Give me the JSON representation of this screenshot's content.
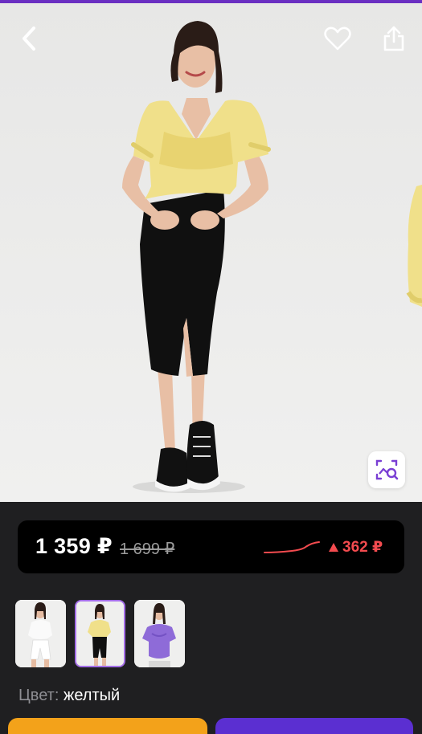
{
  "header": {
    "back_icon": "chevron-left-icon",
    "favorite_icon": "heart-outline-icon",
    "share_icon": "share-icon"
  },
  "hero": {
    "visual_search_icon": "image-search-icon"
  },
  "price": {
    "current": "1 359 ₽",
    "old": "1 699 ₽",
    "change": "362 ₽",
    "change_direction": "up",
    "change_color": "#f34b4f"
  },
  "thumbnails": [
    {
      "color": "white",
      "selected": false
    },
    {
      "color": "yellow",
      "selected": true
    },
    {
      "color": "purple",
      "selected": false
    }
  ],
  "color": {
    "label": "Цвет:",
    "value": "желтый"
  },
  "colors": {
    "accent": "#6a2fc2",
    "selected_border": "#a46ee8",
    "cart_button": "#f3a21a",
    "buy_button": "#5b2fd1"
  }
}
